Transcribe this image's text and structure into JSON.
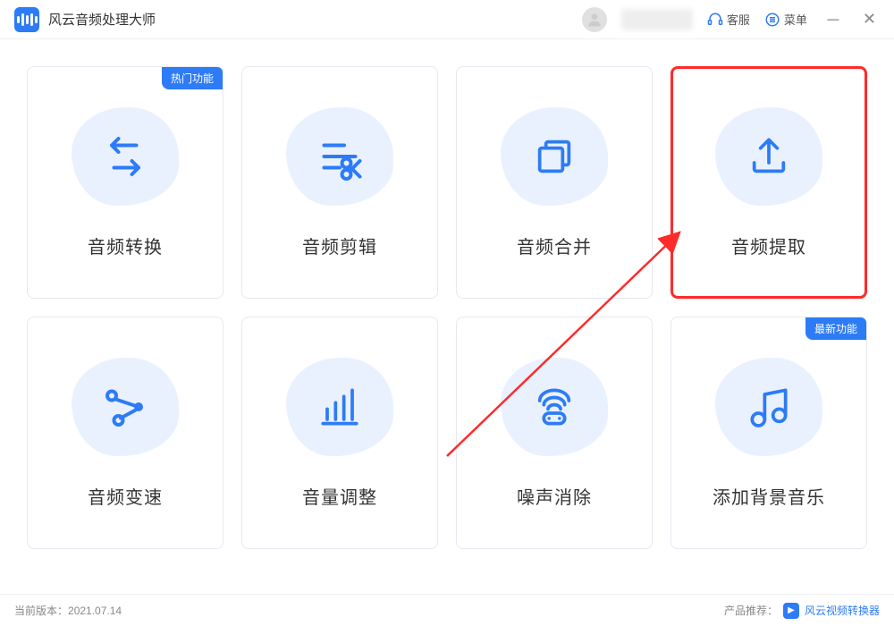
{
  "app": {
    "title": "风云音频处理大师"
  },
  "header": {
    "customer_service": "客服",
    "menu": "菜单"
  },
  "badges": {
    "hot": "热门功能",
    "new": "最新功能"
  },
  "features": [
    {
      "label": "音频转换",
      "icon": "convert"
    },
    {
      "label": "音频剪辑",
      "icon": "cut"
    },
    {
      "label": "音频合并",
      "icon": "merge"
    },
    {
      "label": "音频提取",
      "icon": "extract"
    },
    {
      "label": "音频变速",
      "icon": "speed"
    },
    {
      "label": "音量调整",
      "icon": "volume"
    },
    {
      "label": "噪声消除",
      "icon": "denoise"
    },
    {
      "label": "添加背景音乐",
      "icon": "bgm"
    }
  ],
  "footer": {
    "version_label": "当前版本：",
    "version_value": "2021.07.14",
    "recommend_label": "产品推荐：",
    "recommend_product": "风云视频转换器"
  }
}
